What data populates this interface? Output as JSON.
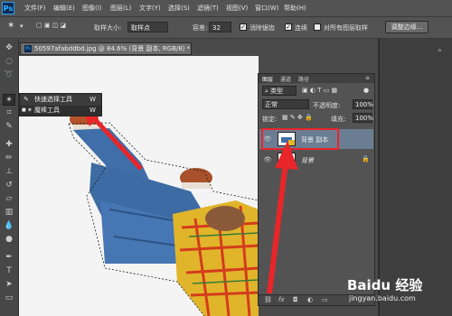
{
  "app": {
    "logo": "Ps"
  },
  "menu": [
    "文件(F)",
    "编辑(E)",
    "图像(I)",
    "图层(L)",
    "文字(Y)",
    "选择(S)",
    "滤镜(T)",
    "视图(V)",
    "窗口(W)",
    "帮助(H)"
  ],
  "options": {
    "sample_size_label": "取样大小:",
    "sample_size_value": "取样点",
    "tolerance_label": "容差:",
    "tolerance_value": "32",
    "antialias_label": "消除锯齿",
    "contiguous_label": "连续",
    "sample_all_label": "对所有图层取样",
    "refine_button": "调整边缘..."
  },
  "document": {
    "tab_title": "50597afabddbd.jpg @ 84.6% (背景 副本, RGB/8) *"
  },
  "flyout": {
    "items": [
      {
        "label": "快速选择工具",
        "key": "W"
      },
      {
        "label": "魔棒工具",
        "key": "W"
      }
    ]
  },
  "layers_panel": {
    "tabs": [
      "图层",
      "通道",
      "路径"
    ],
    "filter_label": "类型",
    "blend_mode": "正常",
    "opacity_label": "不透明度:",
    "opacity_value": "100%",
    "lock_label": "锁定:",
    "fill_label": "填充:",
    "fill_value": "100%",
    "layers": [
      {
        "name": "背景 副本",
        "selected": true
      },
      {
        "name": "背景",
        "selected": false
      }
    ]
  },
  "watermark": {
    "brand": "Baidu 经验",
    "url": "jingyan.baidu.com"
  },
  "colors": {
    "accent": "#e8262a",
    "selection": "#3d6185"
  }
}
